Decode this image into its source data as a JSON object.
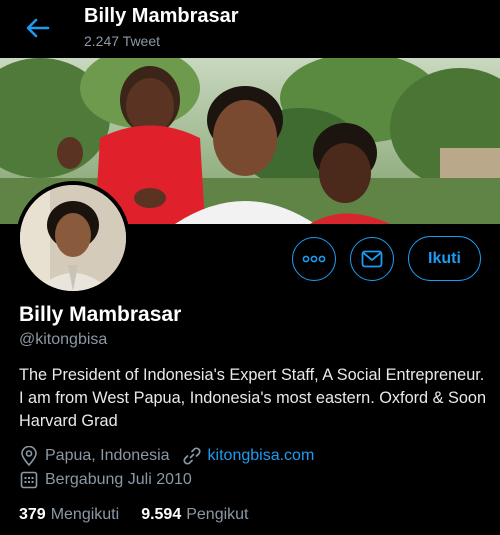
{
  "header": {
    "name": "Billy Mambrasar",
    "tweet_count": "2.247 Tweet"
  },
  "profile": {
    "name": "Billy Mambrasar",
    "handle": "@kitongbisa",
    "bio": "The President of Indonesia's Expert Staff,  A Social Entrepreneur. I am from West Papua, Indonesia's most eastern. Oxford & Soon Harvard Grad",
    "location": "Papua, Indonesia",
    "website": "kitongbisa.com",
    "joined": "Bergabung Juli 2010"
  },
  "actions": {
    "follow_label": "Ikuti"
  },
  "stats": {
    "following_count": "379",
    "following_label": "Mengikuti",
    "followers_count": "9.594",
    "followers_label": "Pengikut"
  },
  "icons": {
    "back": "arrow-left-icon",
    "more": "more-icon",
    "message": "mail-icon",
    "location": "location-pin-icon",
    "link": "link-icon",
    "calendar": "calendar-icon"
  },
  "colors": {
    "accent": "#1d9bf0",
    "background": "#000000",
    "secondary_text": "#8b98a5"
  }
}
